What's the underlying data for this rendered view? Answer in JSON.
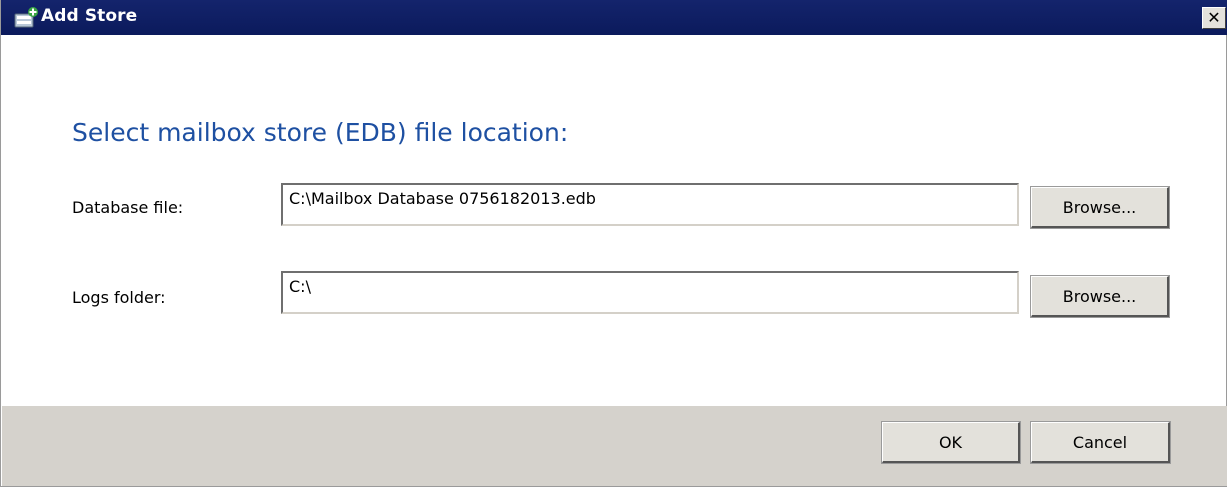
{
  "window": {
    "title": "Add Store",
    "close_glyph": "✕"
  },
  "main": {
    "heading": "Select mailbox store (EDB) file location:",
    "database_label": "Database file:",
    "database_value": "C:\\Mailbox Database 0756182013.edb",
    "logs_label": "Logs folder:",
    "logs_value": "C:\\",
    "browse_label": "Browse..."
  },
  "footer": {
    "ok_label": "OK",
    "cancel_label": "Cancel"
  },
  "icons": {
    "title_icon": "database-store-icon",
    "close_icon": "close-icon"
  },
  "colors": {
    "titlebar": "#0b1a5c",
    "heading": "#1e50a2",
    "footer": "#d5d2cc"
  }
}
